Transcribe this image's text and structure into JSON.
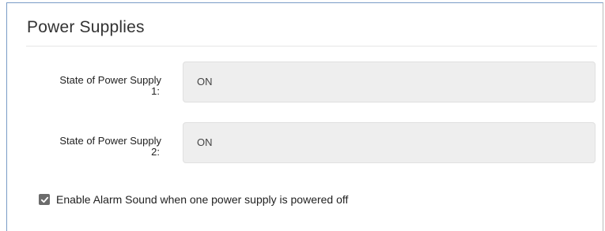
{
  "panel": {
    "title": "Power Supplies"
  },
  "fields": [
    {
      "label_line1": "State of Power Supply",
      "label_line2": "1:",
      "value": "ON"
    },
    {
      "label_line1": "State of Power Supply",
      "label_line2": "2:",
      "value": "ON"
    }
  ],
  "alarm": {
    "checked": true,
    "label": "Enable Alarm Sound when one power supply is powered off",
    "icon": "checkmark-icon"
  },
  "colors": {
    "border_accent": "#7a9cc6",
    "field_background": "#eeeeee",
    "checkbox_fill": "#6b6b6b"
  }
}
